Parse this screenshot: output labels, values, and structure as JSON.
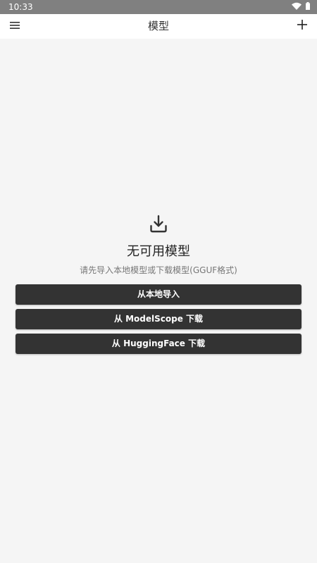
{
  "status_bar": {
    "time": "10:33",
    "icons": [
      "wifi-icon",
      "battery-icon"
    ]
  },
  "app_bar": {
    "title": "模型",
    "menu_icon": "menu-icon",
    "add_icon": "plus-icon"
  },
  "empty_state": {
    "icon": "download-icon",
    "title": "无可用模型",
    "subtitle": "请先导入本地模型或下载模型(GGUF格式)"
  },
  "actions": {
    "import_local": "从本地导入",
    "download_modelscope": "从 ModelScope 下载",
    "download_huggingface": "从 HuggingFace 下载"
  },
  "colors": {
    "status_bar_bg": "#808080",
    "app_bar_bg": "#ffffff",
    "page_bg": "#f5f5f5",
    "button_bg": "#333333",
    "button_text": "#ffffff"
  }
}
